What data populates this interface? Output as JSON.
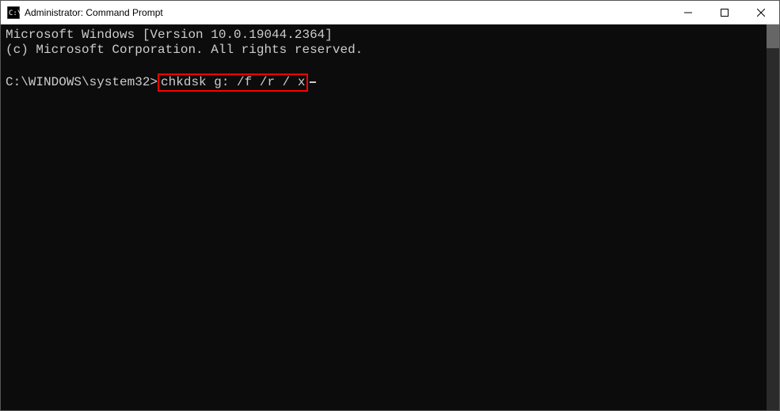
{
  "titlebar": {
    "title": "Administrator: Command Prompt"
  },
  "terminal": {
    "line1": "Microsoft Windows [Version 10.0.19044.2364]",
    "line2": "(c) Microsoft Corporation. All rights reserved.",
    "prompt": "C:\\WINDOWS\\system32>",
    "command": "chkdsk g: /f /r / x"
  }
}
